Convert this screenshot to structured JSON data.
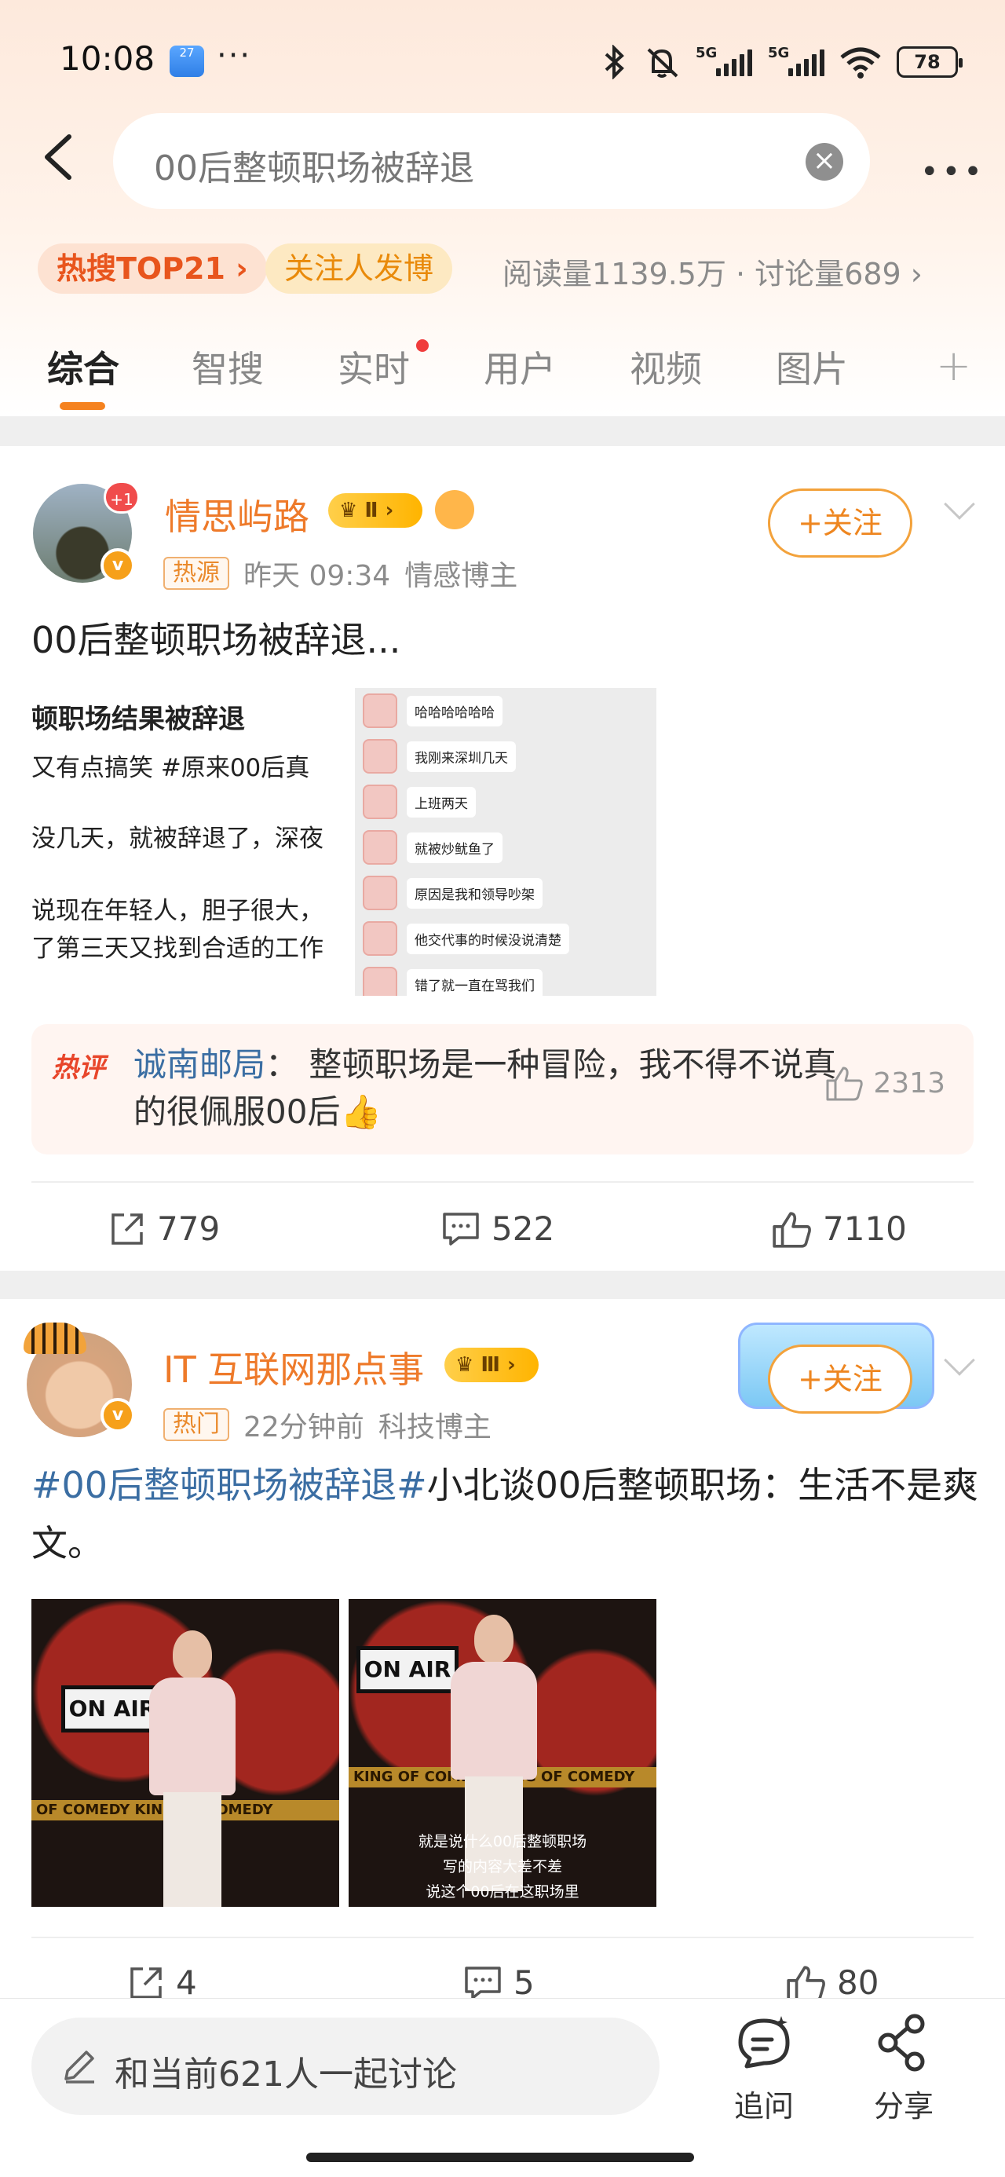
{
  "status_bar": {
    "time": "10:08",
    "weather_badge": "27",
    "dots": "···",
    "net1": "5G",
    "net2": "5G",
    "battery": "78"
  },
  "search": {
    "query": "00后整顿职场被辞退",
    "clear_glyph": "×",
    "more_glyph": "•••"
  },
  "topic_bar": {
    "hot_rank": "热搜TOP21 ›",
    "follow_posts": "关注人发博",
    "stats": "阅读量1139.5万 · 讨论量689 ›"
  },
  "tabs": [
    "综合",
    "智搜",
    "实时",
    "用户",
    "视频",
    "图片"
  ],
  "tabs_add": "+",
  "post1": {
    "username": "情思屿路",
    "level": "Ⅱ",
    "avatar_badge": "+1",
    "verified": "v",
    "tag": "热源",
    "time": "昨天 09:34",
    "category": "情感博主",
    "follow": "+关注",
    "text": "00后整顿职场被辞退...",
    "image_left_lines": [
      "顿职场结果被辞退",
      "又有点搞笑 #原来00后真",
      "没几天，就被辞退了，深夜",
      "说现在年轻人，胆子很大，",
      "了第三天又找到合适的工作"
    ],
    "image_chat": [
      "哈哈哈哈哈哈",
      "我刚来深圳几天",
      "上班两天",
      "就被炒鱿鱼了",
      "原因是我和领导吵架",
      "他交代事的时候没说清楚",
      "错了就一直在骂我们"
    ],
    "hot_comment": {
      "label": "热评",
      "user": "诚南邮局",
      "sep": "：",
      "text": "整顿职场是一种冒险，我不得不说真的很佩服00后👍",
      "likes": "2313"
    },
    "reposts": "779",
    "comments": "522",
    "likes": "7110"
  },
  "post2": {
    "username": "IT 互联网那点事",
    "level": "Ⅲ",
    "verified": "v",
    "tag": "热门",
    "time": "22分钟前",
    "category": "科技博主",
    "follow": "+关注",
    "topic": "#00后整顿职场被辞退#",
    "text": "小北谈00后整顿职场：生活不是爽文。",
    "video1": {
      "sign": "ON AIR",
      "band": "OF COMEDY   KING OF COMEDY"
    },
    "video2": {
      "sign": "ON AIR",
      "band": "KING OF COMEDY   KING OF COMEDY",
      "subs": [
        "就是说什么00后整顿职场",
        "写的内容大差不差",
        "说这个00后在这职场里"
      ]
    },
    "reposts": "4",
    "comments": "5",
    "likes": "80"
  },
  "bottom_bar": {
    "discuss": "和当前621人一起讨论",
    "ask": "追问",
    "share": "分享"
  }
}
